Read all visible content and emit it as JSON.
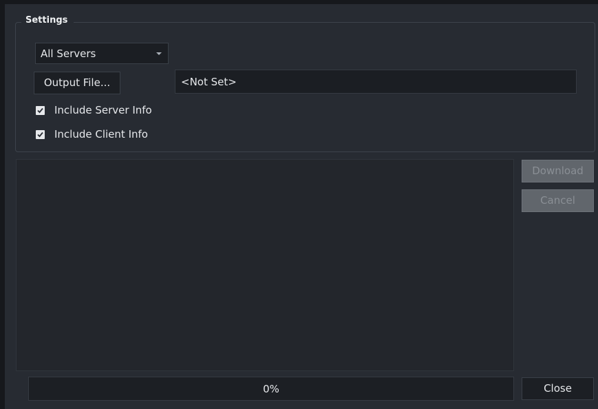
{
  "settings": {
    "title": "Settings",
    "server_select": {
      "selected": "All Servers"
    },
    "output_file_button": "Output File...",
    "output_path": "<Not Set>",
    "checkboxes": [
      {
        "label": "Include Server Info",
        "checked": true
      },
      {
        "label": "Include Client Info",
        "checked": true
      }
    ]
  },
  "log": {
    "lines": []
  },
  "actions": {
    "download_label": "Download",
    "download_enabled": false,
    "cancel_label": "Cancel",
    "cancel_enabled": false,
    "close_label": "Close"
  },
  "progress": {
    "value": 0,
    "text": "0%"
  },
  "colors": {
    "window_bg": "#272b32",
    "field_bg": "#1b1e23",
    "disabled_button_bg": "#61666c",
    "text": "#e6e8eb"
  },
  "icons": {
    "combo_arrow": "chevron-down-icon",
    "checkbox_mark": "check-icon"
  }
}
